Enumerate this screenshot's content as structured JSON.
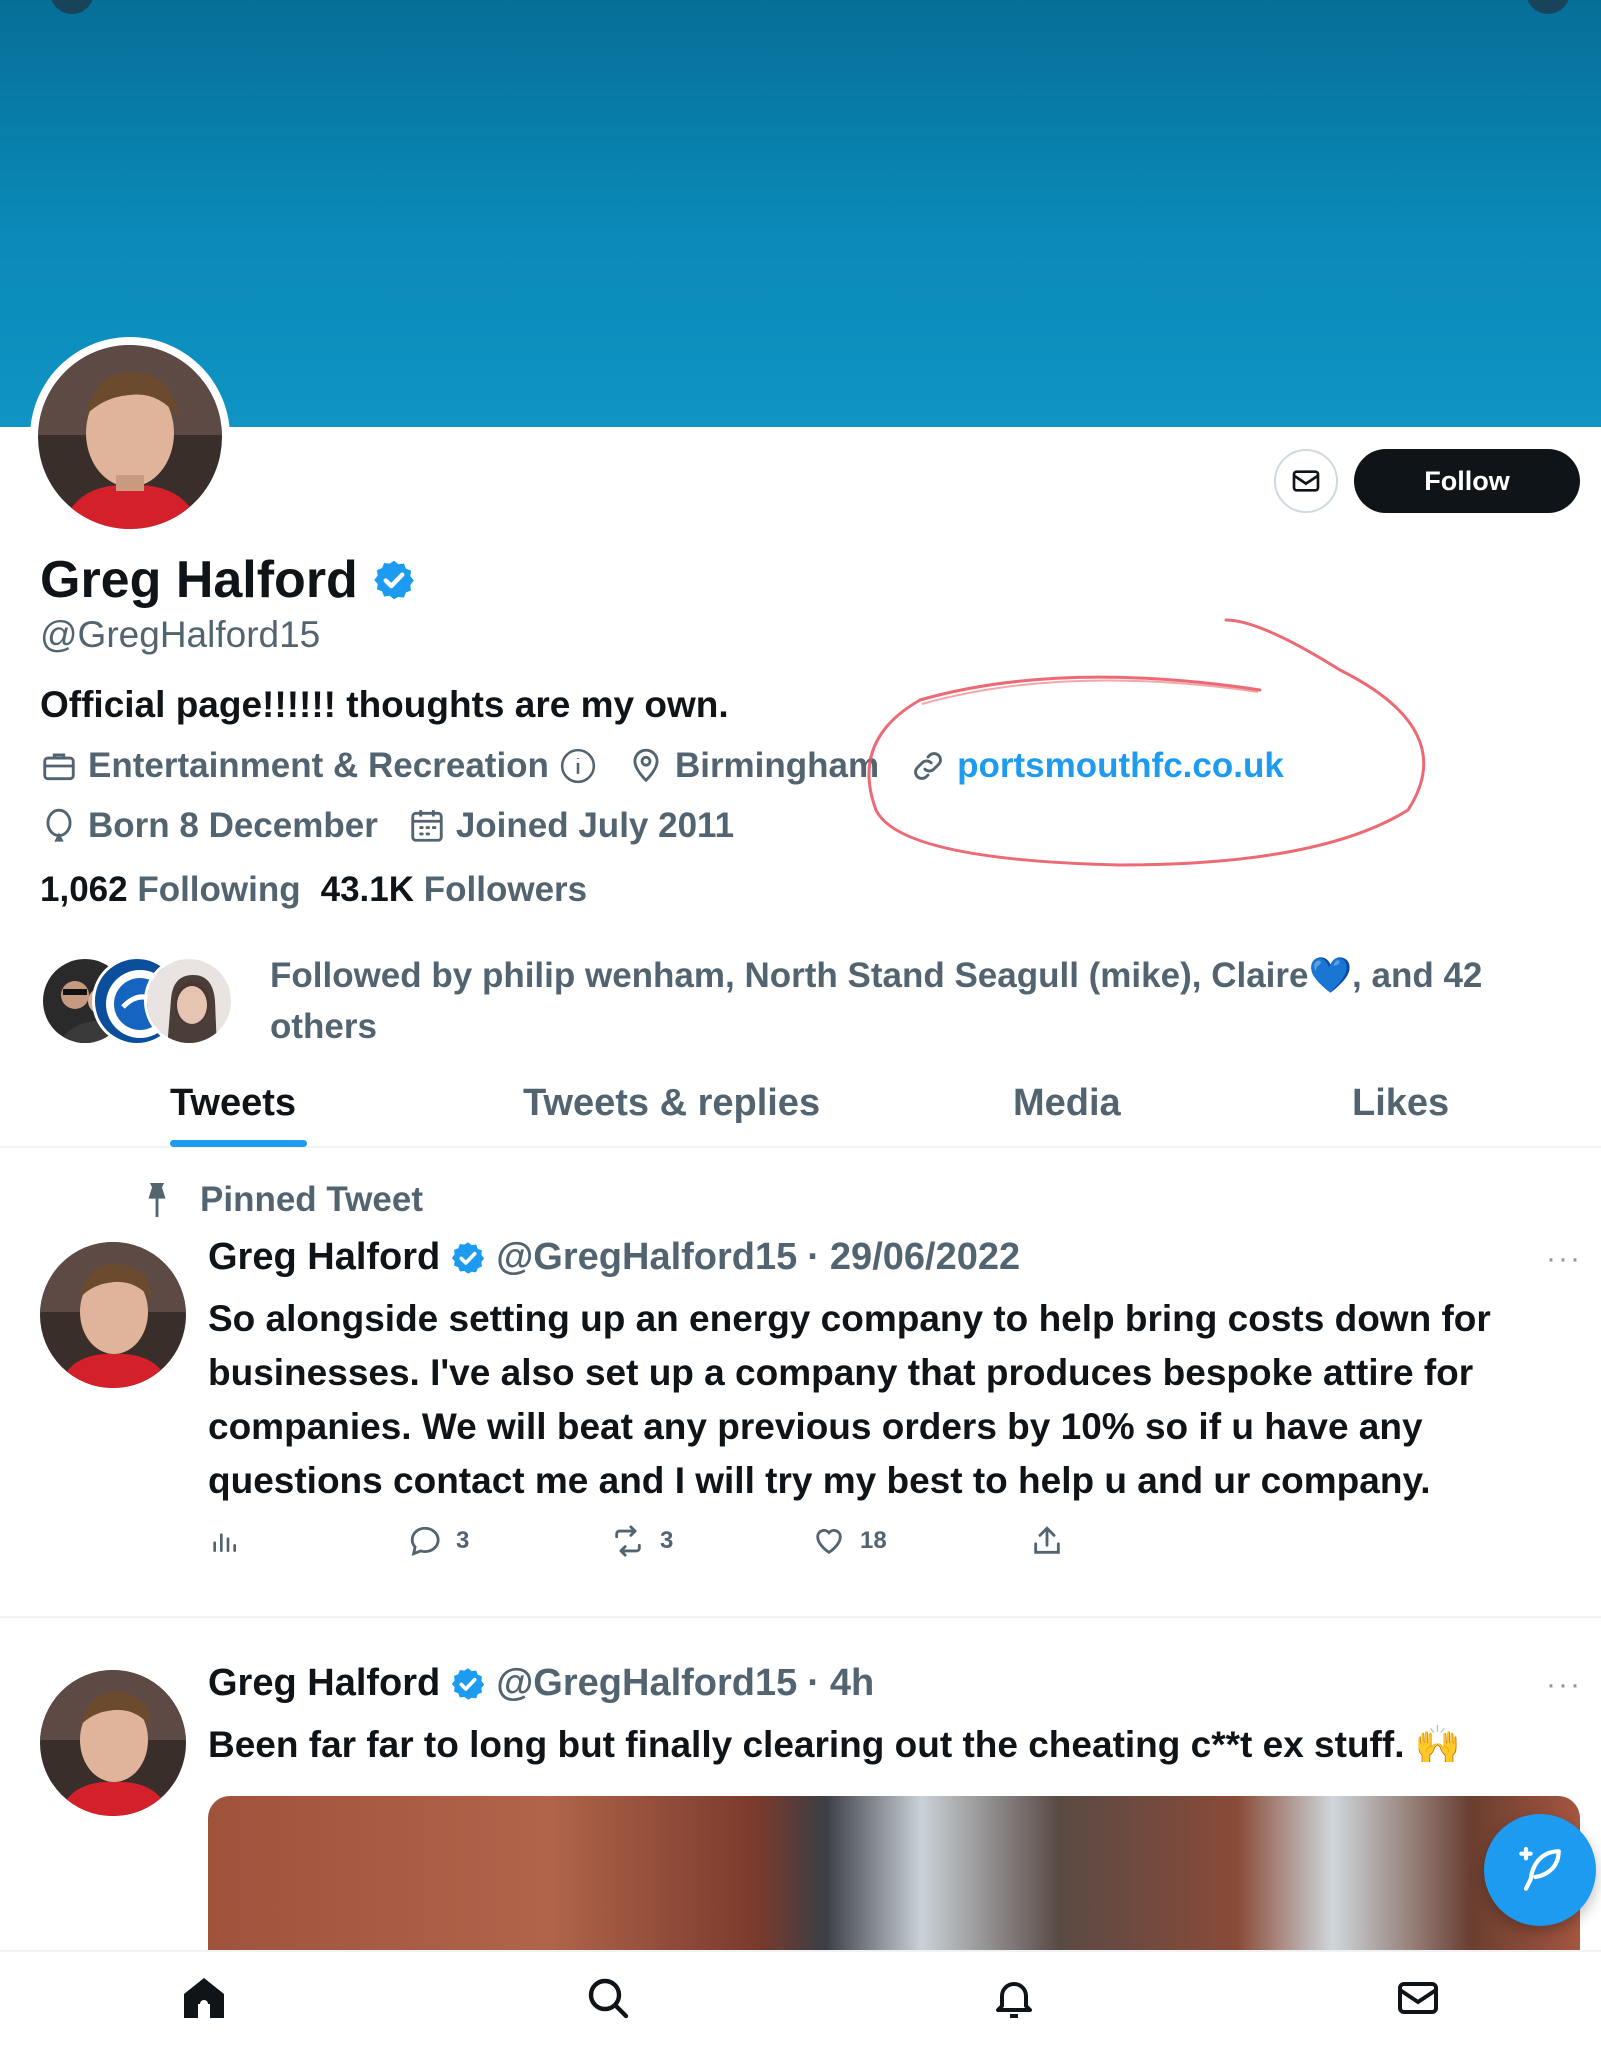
{
  "profile": {
    "name": "Greg Halford",
    "handle": "@GregHalford15",
    "bio": "Official page!!!!!! thoughts are my own.",
    "category": "Entertainment & Recreation",
    "location": "Birmingham",
    "website": "portsmouthfc.co.uk",
    "birthday": "Born 8 December",
    "joined": "Joined July 2011",
    "following_count": "1,062",
    "following_label": "Following",
    "followers_count": "43.1K",
    "followers_label": "Followers",
    "followed_by": "Followed by philip wenham, North Stand Seagull (mike), Claire💙, and 42 others"
  },
  "buttons": {
    "follow": "Follow"
  },
  "tabs": [
    {
      "label": "Tweets"
    },
    {
      "label": "Tweets & replies"
    },
    {
      "label": "Media"
    },
    {
      "label": "Likes"
    }
  ],
  "tweets": [
    {
      "pinned_label": "Pinned Tweet",
      "name": "Greg Halford",
      "handle": "@GregHalford15",
      "sep": "·",
      "time": "29/06/2022",
      "text": "So alongside setting up an energy company to help bring costs down for businesses. I've also set up a company that produces bespoke attire for companies. We will beat any previous orders by 10% so if u have any questions contact me and I will try my best to help u and ur company.",
      "replies": "3",
      "retweets": "3",
      "likes": "18"
    },
    {
      "name": "Greg Halford",
      "handle": "@GregHalford15",
      "sep": "·",
      "time": "4h",
      "text": "Been far far to long but finally clearing out the cheating c**t ex stuff. 🙌"
    }
  ],
  "more_label": "···",
  "colors": {
    "accent": "#1d9bf0",
    "text": "#0f1419",
    "muted": "#536471",
    "annotation": "#e8505b"
  }
}
